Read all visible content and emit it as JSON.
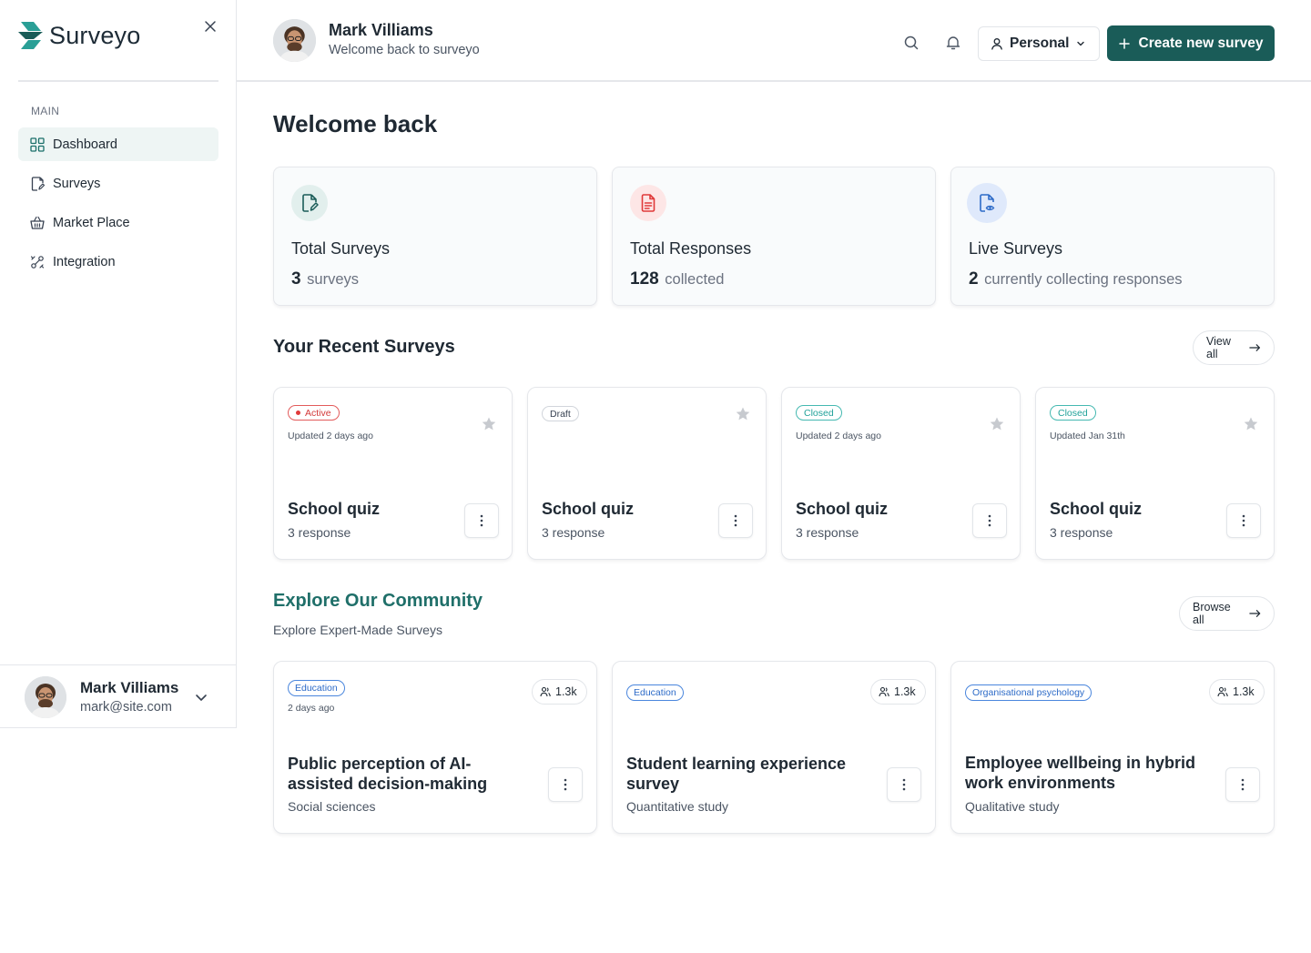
{
  "app": {
    "name": "Surveyo"
  },
  "sidebar": {
    "section_label": "MAIN",
    "items": [
      {
        "label": "Dashboard",
        "icon": "dashboard-icon",
        "active": true
      },
      {
        "label": "Surveys",
        "icon": "surveys-icon",
        "active": false
      },
      {
        "label": "Market Place",
        "icon": "basket-icon",
        "active": false
      },
      {
        "label": "Integration",
        "icon": "integration-icon",
        "active": false
      }
    ],
    "user": {
      "name": "Mark Villiams",
      "email": "mark@site.com"
    }
  },
  "header": {
    "name": "Mark Villiams",
    "subtitle": "Welcome back to surveyo",
    "workspace": "Personal",
    "create_label": "Create new survey"
  },
  "main": {
    "title": "Welcome back",
    "stats": [
      {
        "label": "Total Surveys",
        "value": "3",
        "unit": "surveys",
        "icon": "edit-document-icon",
        "color": "#1a5c58"
      },
      {
        "label": "Total Responses",
        "value": "128",
        "unit": "collected",
        "icon": "document-icon",
        "color": "#e03a3a"
      },
      {
        "label": "Live Surveys",
        "value": "2",
        "unit": "currently collecting responses",
        "icon": "document-eye-icon",
        "color": "#2d6bc8"
      }
    ],
    "recent": {
      "heading": "Your Recent Surveys",
      "view_all": "View all",
      "cards": [
        {
          "status": "Active",
          "updated": "Updated 2 days ago",
          "title": "School quiz",
          "responses": "3 response"
        },
        {
          "status": "Draft",
          "updated": "",
          "title": "School quiz",
          "responses": "3 response"
        },
        {
          "status": "Closed",
          "updated": "Updated 2 days ago",
          "title": "School quiz",
          "responses": "3 response"
        },
        {
          "status": "Closed",
          "updated": "Updated Jan 31th",
          "title": "School quiz",
          "responses": "3 response"
        }
      ]
    },
    "community": {
      "heading": "Explore Our Community",
      "subheading": "Explore Expert-Made Surveys",
      "browse_all": "Browse all",
      "cards": [
        {
          "category": "Education",
          "date": "2 days ago",
          "count": "1.3k",
          "title": "Public perception of AI-assisted decision-making",
          "type": "Social sciences"
        },
        {
          "category": "Education",
          "date": "",
          "count": "1.3k",
          "title": "Student learning experience survey",
          "type": "Quantitative study"
        },
        {
          "category": "Organisational psychology",
          "date": "",
          "count": "1.3k",
          "title": "Employee wellbeing in hybrid work environments",
          "type": "Qualitative study"
        }
      ]
    }
  },
  "colors": {
    "primary": "#1a5c58",
    "accent_text": "#1f6f69",
    "active_red": "#e03a3a",
    "closed_teal": "#22a29a",
    "category_blue": "#2d6bc8"
  }
}
